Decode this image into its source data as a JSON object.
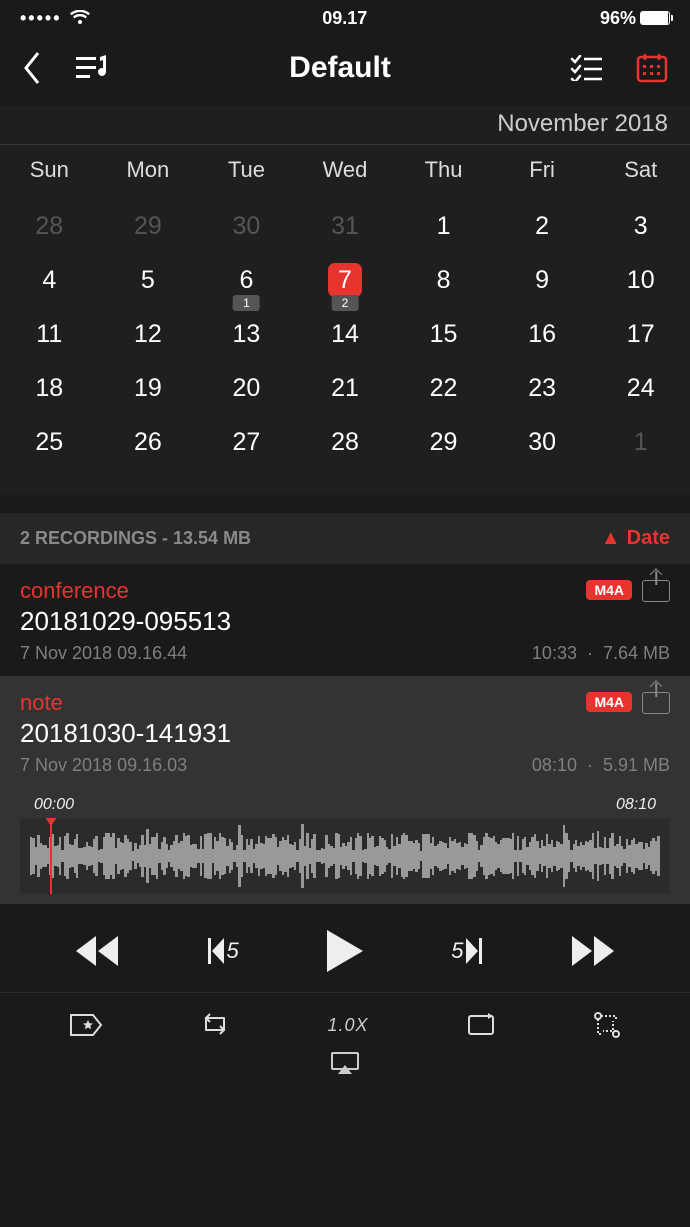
{
  "statusbar": {
    "time": "09.17",
    "battery_pct": "96%"
  },
  "header": {
    "title": "Default"
  },
  "calendar": {
    "month_label": "November 2018",
    "dow": [
      "Sun",
      "Mon",
      "Tue",
      "Wed",
      "Thu",
      "Fri",
      "Sat"
    ],
    "weeks": [
      [
        {
          "n": "28",
          "dim": true
        },
        {
          "n": "29",
          "dim": true
        },
        {
          "n": "30",
          "dim": true
        },
        {
          "n": "31",
          "dim": true
        },
        {
          "n": "1"
        },
        {
          "n": "2"
        },
        {
          "n": "3"
        }
      ],
      [
        {
          "n": "4"
        },
        {
          "n": "5"
        },
        {
          "n": "6",
          "badge": "1"
        },
        {
          "n": "7",
          "today": true,
          "badge": "2"
        },
        {
          "n": "8"
        },
        {
          "n": "9"
        },
        {
          "n": "10"
        }
      ],
      [
        {
          "n": "11"
        },
        {
          "n": "12"
        },
        {
          "n": "13"
        },
        {
          "n": "14"
        },
        {
          "n": "15"
        },
        {
          "n": "16"
        },
        {
          "n": "17"
        }
      ],
      [
        {
          "n": "18"
        },
        {
          "n": "19"
        },
        {
          "n": "20"
        },
        {
          "n": "21"
        },
        {
          "n": "22"
        },
        {
          "n": "23"
        },
        {
          "n": "24"
        }
      ],
      [
        {
          "n": "25"
        },
        {
          "n": "26"
        },
        {
          "n": "27"
        },
        {
          "n": "28"
        },
        {
          "n": "29"
        },
        {
          "n": "30"
        },
        {
          "n": "1",
          "dim": true
        }
      ]
    ]
  },
  "list": {
    "summary": "2 RECORDINGS  -  13.54 MB",
    "sort_label": "Date",
    "items": [
      {
        "name": "conference",
        "title": "20181029-095513",
        "datetime": "7 Nov 2018 09.16.44",
        "duration": "10:33",
        "size": "7.64 MB",
        "format": "M4A",
        "selected": false
      },
      {
        "name": "note",
        "title": "20181030-141931",
        "datetime": "7 Nov 2018 09.16.03",
        "duration": "08:10",
        "size": "5.91 MB",
        "format": "M4A",
        "selected": true
      }
    ]
  },
  "wave": {
    "start": "00:00",
    "end": "08:10"
  },
  "controls": {
    "skip_back": "5",
    "skip_fwd": "5",
    "speed": "1.0X"
  }
}
